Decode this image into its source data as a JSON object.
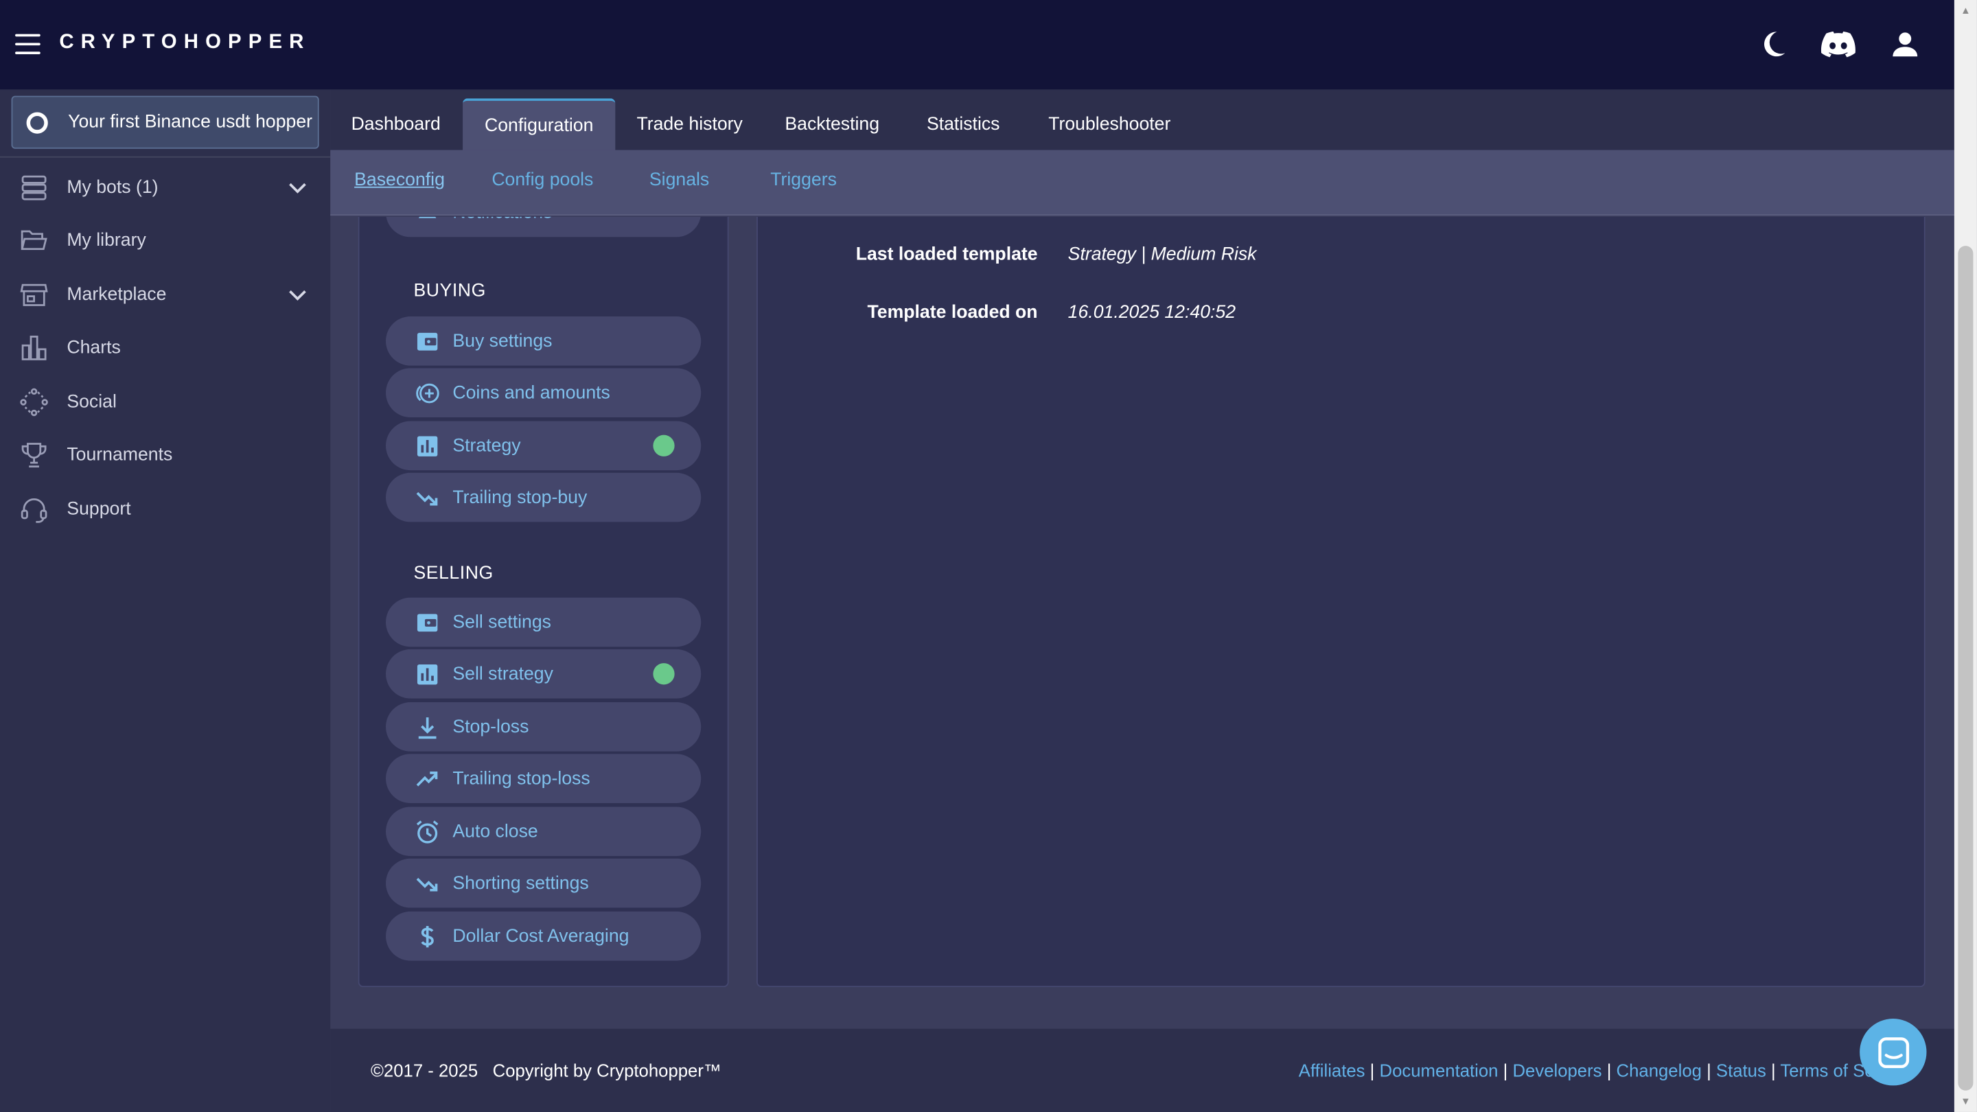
{
  "app": {
    "logo": "CRYPTOHOPPER",
    "colors": {
      "accent": "#49a2d6",
      "header_bg": "#121338",
      "sidebar_bg": "#2d2f4c",
      "status_green": "#6ac98b"
    }
  },
  "header": {
    "icons": [
      "moon-icon",
      "discord-icon",
      "user-icon"
    ]
  },
  "sidebar": {
    "hopper_label": "Your first Binance usdt hopper",
    "items": [
      {
        "label": "My bots (1)",
        "icon": "stack-icon",
        "expandable": true
      },
      {
        "label": "My library",
        "icon": "folder-icon",
        "expandable": false
      },
      {
        "label": "Marketplace",
        "icon": "store-icon",
        "expandable": true
      },
      {
        "label": "Charts",
        "icon": "chart-icon",
        "expandable": false
      },
      {
        "label": "Social",
        "icon": "social-icon",
        "expandable": false
      },
      {
        "label": "Tournaments",
        "icon": "trophy-icon",
        "expandable": false
      },
      {
        "label": "Support",
        "icon": "headset-icon",
        "expandable": false
      }
    ]
  },
  "tabs": [
    {
      "label": "Dashboard",
      "active": false
    },
    {
      "label": "Configuration",
      "active": true
    },
    {
      "label": "Trade history",
      "active": false
    },
    {
      "label": "Backtesting",
      "active": false
    },
    {
      "label": "Statistics",
      "active": false
    },
    {
      "label": "Troubleshooter",
      "active": false
    }
  ],
  "subtabs": [
    {
      "label": "Baseconfig",
      "active": true
    },
    {
      "label": "Config pools",
      "active": false
    },
    {
      "label": "Signals",
      "active": false
    },
    {
      "label": "Triggers",
      "active": false
    }
  ],
  "config_menu": {
    "partial_item": "Notifications",
    "buying_title": "BUYING",
    "buying": [
      {
        "label": "Buy settings",
        "icon": "wallet-icon",
        "status": false
      },
      {
        "label": "Coins and amounts",
        "icon": "coins-icon",
        "status": false
      },
      {
        "label": "Strategy",
        "icon": "bar-chart-icon",
        "status": true
      },
      {
        "label": "Trailing stop-buy",
        "icon": "trend-down-icon",
        "status": false
      }
    ],
    "selling_title": "SELLING",
    "selling": [
      {
        "label": "Sell settings",
        "icon": "wallet-icon",
        "status": false
      },
      {
        "label": "Sell strategy",
        "icon": "bar-chart-icon",
        "status": true
      },
      {
        "label": "Stop-loss",
        "icon": "download-icon",
        "status": false
      },
      {
        "label": "Trailing stop-loss",
        "icon": "trend-up-icon",
        "status": false
      },
      {
        "label": "Auto close",
        "icon": "alarm-icon",
        "status": false
      },
      {
        "label": "Shorting settings",
        "icon": "trend-down-icon",
        "status": false
      },
      {
        "label": "Dollar Cost Averaging",
        "icon": "dollar-icon",
        "status": false
      }
    ]
  },
  "template_info": {
    "last_loaded_label": "Last loaded template",
    "last_loaded_value": "Strategy | Medium Risk",
    "loaded_on_label": "Template loaded on",
    "loaded_on_value": "16.01.2025 12:40:52"
  },
  "footer": {
    "copyright": "©2017 - 2025   Copyright by Cryptohopper™",
    "links": [
      "Affiliates",
      "Documentation",
      "Developers",
      "Changelog",
      "Status",
      "Terms of Se"
    ]
  }
}
